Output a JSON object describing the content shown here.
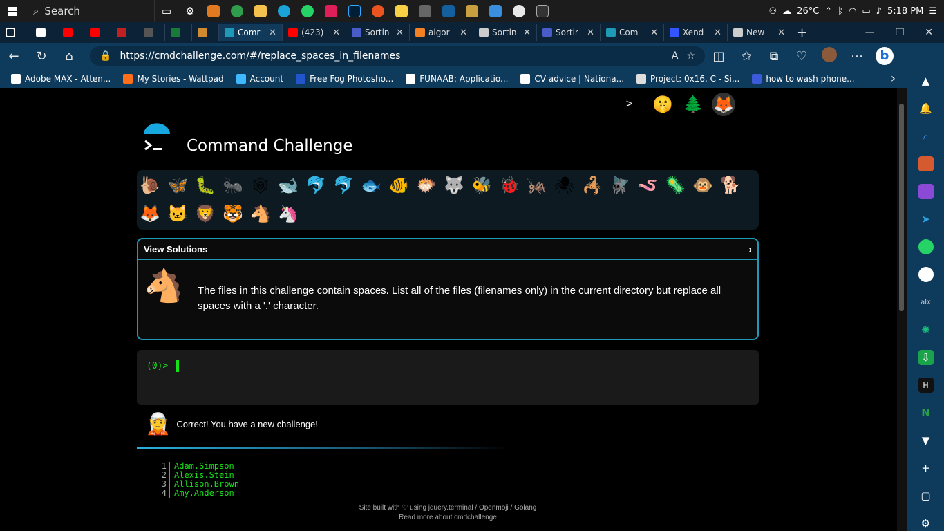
{
  "taskbar": {
    "search_label": "Search",
    "weather_temp": "26°C",
    "time": "5:18 PM"
  },
  "tabs": [
    {
      "label": "",
      "fav_color": "#ffffff"
    },
    {
      "label": "",
      "fav_color": "#ff0000"
    },
    {
      "label": "",
      "fav_color": "#ff0000"
    },
    {
      "label": "",
      "fav_color": "#c02020"
    },
    {
      "label": "",
      "fav_color": "#555555"
    },
    {
      "label": "",
      "fav_color": "#1a7a3a"
    },
    {
      "label": "",
      "fav_color": "#d08a30"
    },
    {
      "label": "Comr",
      "fav_color": "#1f9ab6"
    },
    {
      "label": "(423)",
      "fav_color": "#ff0000"
    },
    {
      "label": "Sortin",
      "fav_color": "#4a5cc8"
    },
    {
      "label": "algor",
      "fav_color": "#f48024"
    },
    {
      "label": "Sortin",
      "fav_color": "#cccccc"
    },
    {
      "label": "Sortir",
      "fav_color": "#4a5cc8"
    },
    {
      "label": "Com",
      "fav_color": "#1f9ab6"
    },
    {
      "label": "Xend",
      "fav_color": "#3355ff"
    },
    {
      "label": "New",
      "fav_color": "#cccccc"
    }
  ],
  "address": {
    "url": "https://cmdchallenge.com/#/replace_spaces_in_filenames"
  },
  "bookmarks": [
    {
      "label": "Adobe MAX - Atten...",
      "color": "#ffffff"
    },
    {
      "label": "My Stories - Wattpad",
      "color": "#ff6e1a"
    },
    {
      "label": "Account",
      "color": "#3fb8ff"
    },
    {
      "label": "Free Fog Photosho...",
      "color": "#2255cc"
    },
    {
      "label": "FUNAAB: Applicatio...",
      "color": "#ffffff"
    },
    {
      "label": "CV advice | Nationa...",
      "color": "#ffffff"
    },
    {
      "label": "Project: 0x16. C - Si...",
      "color": "#dddddd"
    },
    {
      "label": "how to wash phone...",
      "color": "#3b5bdb"
    }
  ],
  "page": {
    "title": "Command Challenge",
    "view_solutions": "View Solutions",
    "challenge_text": "The files in this challenge contain spaces. List all of the files (filenames only) in the current directory but replace all spaces with a '.' character.",
    "prompt": "(0)>",
    "correct_message": "Correct! You have a new challenge!",
    "files": [
      {
        "num": "1",
        "name": "Adam.Simpson"
      },
      {
        "num": "2",
        "name": "Alexis.Stein"
      },
      {
        "num": "3",
        "name": "Allison.Brown"
      },
      {
        "num": "4",
        "name": "Amy.Anderson"
      }
    ],
    "footer_line1": "Site built with ♡ using jquery.terminal / Openmoji / Golang",
    "footer_line2": "Read more about cmdchallenge"
  },
  "animals": [
    "🐌",
    "🦋",
    "🐛",
    "🐜",
    "🕸",
    "🐋",
    "🐬",
    "🐬",
    "🐟",
    "🐠",
    "🐡",
    "🐺",
    "🐝",
    "🐞",
    "🦗",
    "🕷",
    "🦂",
    "🪰",
    "🪱",
    "🦠",
    "🐵",
    "🐕",
    "🦊",
    "🐱",
    "🦁",
    "🐯",
    "🐴",
    "🦄"
  ],
  "colors": {
    "accent": "#1f9ab6",
    "terminal_green": "#17e01a",
    "browser_bg": "#0e3a5c"
  }
}
